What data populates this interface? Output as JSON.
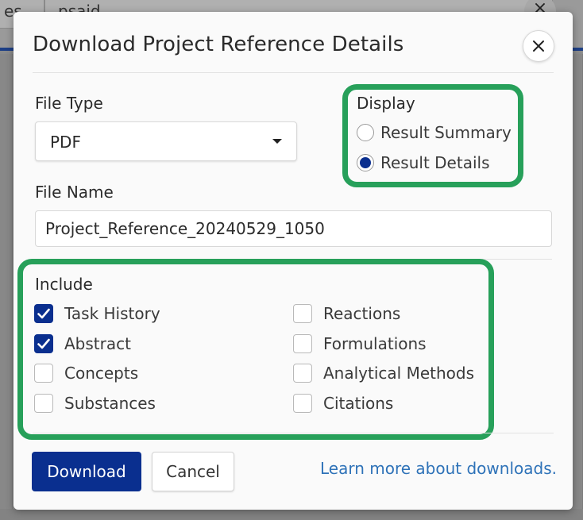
{
  "background": {
    "tab1_text": "es",
    "tab2_text": "psaid",
    "tab_close_glyph": "×"
  },
  "dialog": {
    "title": "Download Project Reference Details",
    "close_icon": "close-icon"
  },
  "file_type": {
    "label": "File Type",
    "selected": "PDF"
  },
  "display": {
    "label": "Display",
    "options": [
      {
        "label": "Result Summary",
        "selected": false
      },
      {
        "label": "Result Details",
        "selected": true
      }
    ]
  },
  "file_name": {
    "label": "File Name",
    "value": "Project_Reference_20240529_1050"
  },
  "include": {
    "label": "Include",
    "left": [
      {
        "label": "Task History",
        "checked": true
      },
      {
        "label": "Abstract",
        "checked": true
      },
      {
        "label": "Concepts",
        "checked": false
      },
      {
        "label": "Substances",
        "checked": false
      }
    ],
    "right": [
      {
        "label": "Reactions",
        "checked": false
      },
      {
        "label": "Formulations",
        "checked": false
      },
      {
        "label": "Analytical Methods",
        "checked": false
      },
      {
        "label": "Citations",
        "checked": false
      }
    ]
  },
  "actions": {
    "download_label": "Download",
    "cancel_label": "Cancel",
    "learn_more_label": "Learn more about downloads."
  },
  "colors": {
    "primary": "#0a2f8f",
    "highlight": "#27a05a",
    "link": "#2e72b8"
  }
}
